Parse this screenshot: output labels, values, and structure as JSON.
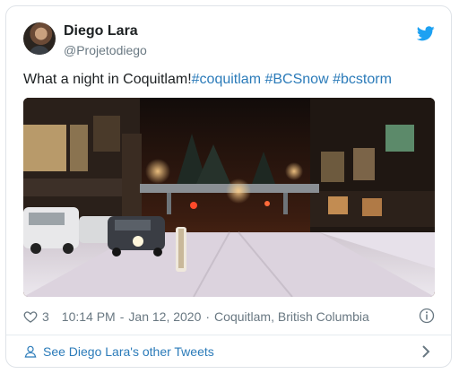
{
  "author": {
    "name": "Diego Lara",
    "handle": "@Projetodiego"
  },
  "tweet": {
    "text_prefix": "What a night in Coquitlam!",
    "hashtags": [
      "#coquitlam",
      "#BCSnow",
      "#bcstorm"
    ]
  },
  "meta": {
    "likes": "3",
    "time": "10:14 PM",
    "date_separator": "-",
    "date": "Jan 12, 2020",
    "dot": "·",
    "location": "Coquitlam, British Columbia"
  },
  "footer": {
    "see_more": "See Diego Lara's other Tweets"
  },
  "icons": {
    "brand": "twitter-bird-icon",
    "like": "heart-icon",
    "info": "info-icon",
    "profile": "person-icon",
    "more": "chevron-right-icon"
  },
  "colors": {
    "link": "#2b7bb9",
    "twitter_blue": "#1da1f2",
    "muted": "#697882"
  }
}
